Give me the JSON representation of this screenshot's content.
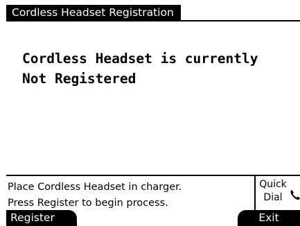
{
  "header": {
    "title": "Cordless Headset Registration"
  },
  "status_message": {
    "line1": "Cordless Headset is currently",
    "line2": "Not Registered"
  },
  "instructions": {
    "line1": "Place Cordless Headset in charger.",
    "line2": "Press Register to begin process."
  },
  "quick_dial": {
    "line1": "Quick",
    "line2": "Dial",
    "icon": "handset-icon"
  },
  "softkeys": {
    "left_label": "Register",
    "right_label": "Exit"
  }
}
